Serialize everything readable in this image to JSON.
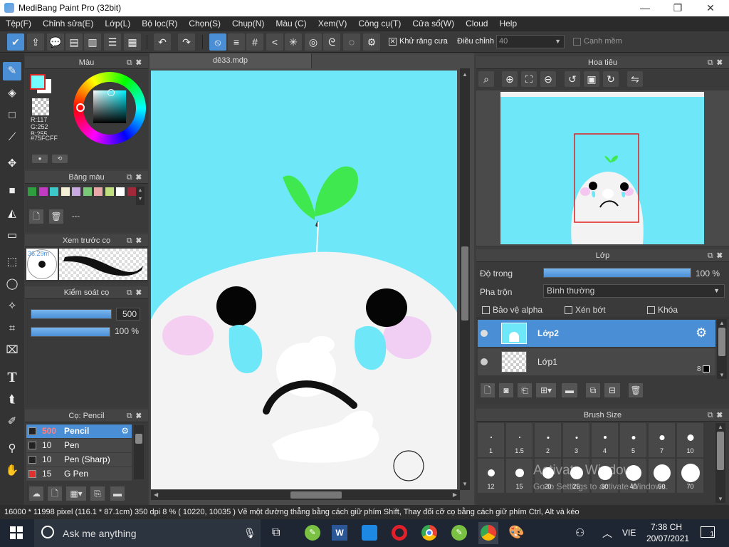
{
  "window": {
    "title": "MediBang Paint Pro (32bit)"
  },
  "menu": [
    "Tệp(F)",
    "Chỉnh sửa(E)",
    "Lớp(L)",
    "Bộ lọc(R)",
    "Chọn(S)",
    "Chụp(N)",
    "Màu (C)",
    "Xem(V)",
    "Công cụ(T)",
    "Cửa sổ(W)",
    "Cloud",
    "Help"
  ],
  "toolbar": {
    "antialias_label": "Khử răng cưa",
    "adjust_label": "Điều chỉnh",
    "adjust_value": "40",
    "softedge_label": "Cạnh mềm"
  },
  "color_panel": {
    "title": "Màu",
    "r": "R:117",
    "g": "G:252",
    "b": "B:255",
    "hex": "#75FCFF",
    "fg": "#75FCFF"
  },
  "palette_panel": {
    "title": "Bảng màu",
    "colors": [
      "#2e9e3e",
      "#c33bc2",
      "#3cc8c8",
      "#f4f0d8",
      "#c8a8e0",
      "#78c878",
      "#e8a8a8",
      "#c0e080",
      "#ffffff",
      "#a02838"
    ],
    "name": "---"
  },
  "preview_panel": {
    "title": "Xem trước cọ",
    "size": "36.29m"
  },
  "control_panel": {
    "title": "Kiểm soát cọ",
    "size": "500",
    "opacity": "100 %",
    "size_frac": 1.0,
    "opacity_frac": 1.0
  },
  "brush_panel": {
    "title": "Cọ: Pencil",
    "items": [
      {
        "size": "500",
        "name": "Pencil",
        "color": "#222"
      },
      {
        "size": "10",
        "name": "Pen",
        "color": "#222"
      },
      {
        "size": "10",
        "name": "Pen (Sharp)",
        "color": "#222"
      },
      {
        "size": "15",
        "name": "G Pen",
        "color": "#e03030"
      }
    ]
  },
  "canvas": {
    "doc_name": "dê33.mdp",
    "bg": "#6ee8f8"
  },
  "navigator": {
    "title": "Hoa tiêu"
  },
  "layers": {
    "title": "Lớp",
    "opacity_label": "Độ trong",
    "opacity_value": "100 %",
    "opacity_frac": 1.0,
    "blend_label": "Pha trộn",
    "blend_value": "Bình thường",
    "protect_alpha": "Bảo vệ alpha",
    "clipping": "Xén bớt",
    "lock": "Khóa",
    "items": [
      {
        "name": "Lớp2",
        "badge": ""
      },
      {
        "name": "Lớp1",
        "badge": "8"
      }
    ]
  },
  "brush_size": {
    "title": "Brush Size",
    "sizes": [
      "1",
      "1.5",
      "2",
      "3",
      "4",
      "5",
      "7",
      "10",
      "12",
      "15",
      "20",
      "25",
      "30",
      "40",
      "50",
      "70"
    ],
    "watermark1": "Activate Windows",
    "watermark2": "Go to Settings to activate Windows."
  },
  "status": {
    "text": "16000 * 11998 pixel   (116.1 * 87.1cm)   350 dpi   8 %   ( 10220, 10035 )   Vẽ một đường thẳng bằng cách giữ phím Shift, Thay đổi cỡ cọ bằng cách giữ phím Ctrl, Alt và kéo"
  },
  "taskbar": {
    "search": "Ask me anything",
    "lang": "VIE",
    "time": "7:38 CH",
    "date": "20/07/2021",
    "notif": "1"
  }
}
